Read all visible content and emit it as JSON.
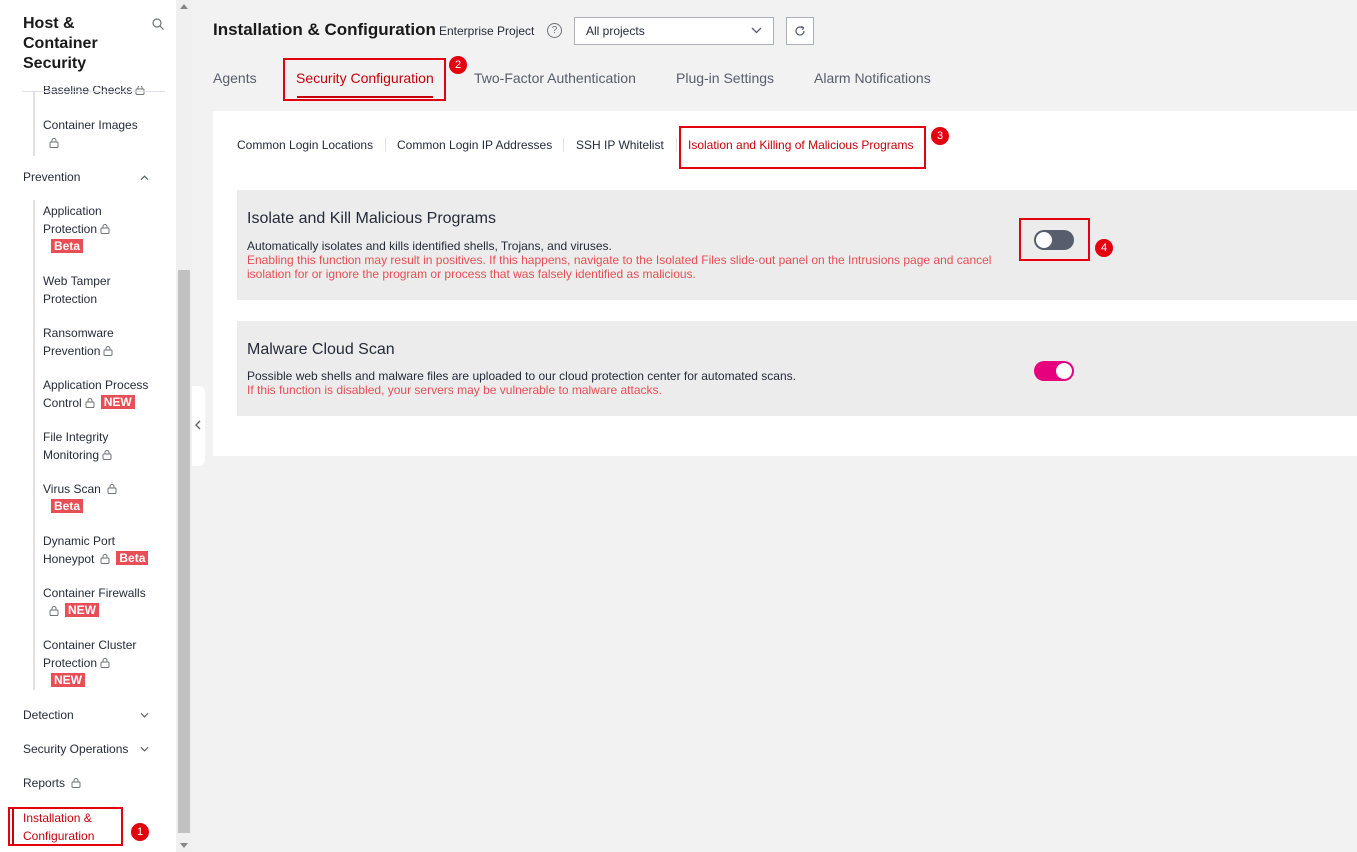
{
  "sidebar": {
    "title": "Host & Container Security",
    "partial_item": "Baseline Checks",
    "container_images": "Container Images",
    "prevention": "Prevention",
    "items": [
      {
        "label_line1": "Application",
        "label_line2": "Protection",
        "badge": "Beta"
      },
      {
        "label_line1": "Web Tamper",
        "label_line2": "Protection",
        "badge": ""
      },
      {
        "label_line1": "Ransomware",
        "label_line2": "Prevention",
        "badge": ""
      },
      {
        "label_line1": "Application Process",
        "label_line2": "Control",
        "badge": "NEW"
      },
      {
        "label_line1": "File Integrity",
        "label_line2": "Monitoring",
        "badge": ""
      },
      {
        "label_line1": "Virus Scan",
        "label_line2": "",
        "badge": "Beta"
      },
      {
        "label_line1": "Dynamic Port",
        "label_line2": "Honeypot",
        "badge": "Beta"
      },
      {
        "label_line1": "Container Firewalls",
        "label_line2": "",
        "badge": "NEW"
      },
      {
        "label_line1": "Container Cluster",
        "label_line2": "Protection",
        "badge": "NEW"
      }
    ],
    "detection": "Detection",
    "security_operations": "Security Operations",
    "reports": "Reports",
    "active_line1": "Installation &",
    "active_line2": "Configuration"
  },
  "header": {
    "title": "Installation & Configuration",
    "enterprise_project_label": "Enterprise Project",
    "help": "?",
    "project_select": "All projects"
  },
  "tabs": [
    "Agents",
    "Security Configuration",
    "Two-Factor Authentication",
    "Plug-in Settings",
    "Alarm Notifications"
  ],
  "subtabs": [
    "Common Login Locations",
    "Common Login IP Addresses",
    "SSH IP Whitelist",
    "Isolation and Killing of Malicious Programs"
  ],
  "panels": [
    {
      "title": "Isolate and Kill Malicious Programs",
      "desc": "Automatically isolates and kills identified shells, Trojans, and viruses.",
      "warn": "Enabling this function may result in positives. If this happens, navigate to the Isolated Files slide-out panel on the Intrusions page and cancel isolation for or ignore the program or process that was falsely identified as malicious.",
      "enabled": false
    },
    {
      "title": "Malware Cloud Scan",
      "desc": "Possible web shells and malware files are uploaded to our cloud protection center for automated scans.",
      "warn": "If this function is disabled, your servers may be vulnerable to malware attacks.",
      "enabled": true
    }
  ],
  "annotations": [
    "1",
    "2",
    "3",
    "4"
  ],
  "colors": {
    "accent": "#c7000b",
    "toggle_on": "#e6007e",
    "toggle_off": "#575d6c",
    "warning": "#e84e55",
    "annotation": "#e3000f"
  }
}
